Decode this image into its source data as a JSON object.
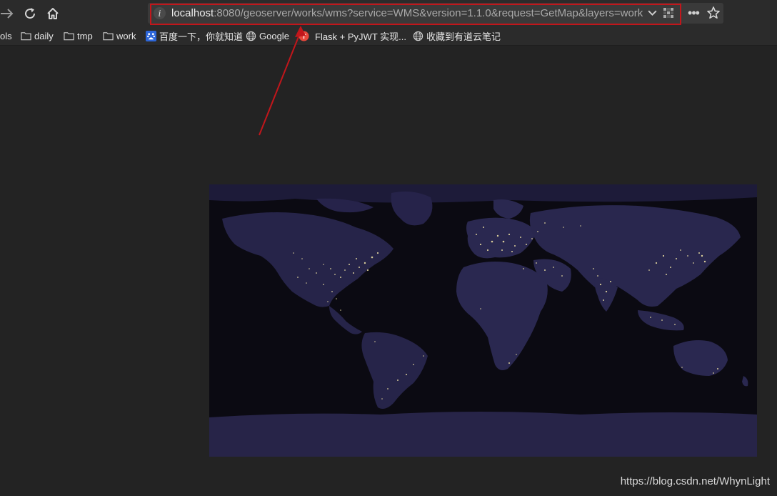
{
  "browser": {
    "url": {
      "host": "localhost",
      "rest": ":8080/geoserver/works/wms?service=WMS&version=1.1.0&request=GetMap&layers=works:"
    },
    "more_label": "•••",
    "icons": {
      "back": "back-arrow-icon",
      "reload": "reload-icon",
      "home": "home-icon",
      "site_info": "info-icon",
      "dropdown": "chevron-down-icon",
      "qr": "qr-code-icon",
      "star": "star-icon"
    },
    "highlight_color": "#c2161b"
  },
  "bookmarks": [
    {
      "label": "ols",
      "icon": "none"
    },
    {
      "label": "daily",
      "icon": "folder-icon"
    },
    {
      "label": "tmp",
      "icon": "folder-icon"
    },
    {
      "label": "work",
      "icon": "folder-icon"
    },
    {
      "label": "百度一下，你就知道",
      "icon": "baidu-icon"
    },
    {
      "label": "Google",
      "icon": "globe-icon"
    },
    {
      "label": "Flask + PyJWT 实现...",
      "icon": "red-badge-icon"
    },
    {
      "label": "收藏到有道云笔记",
      "icon": "globe-icon"
    }
  ],
  "content": {
    "map_description_icon": "world-night-lights-map",
    "watermark": "https://blog.csdn.net/WhynLight"
  }
}
